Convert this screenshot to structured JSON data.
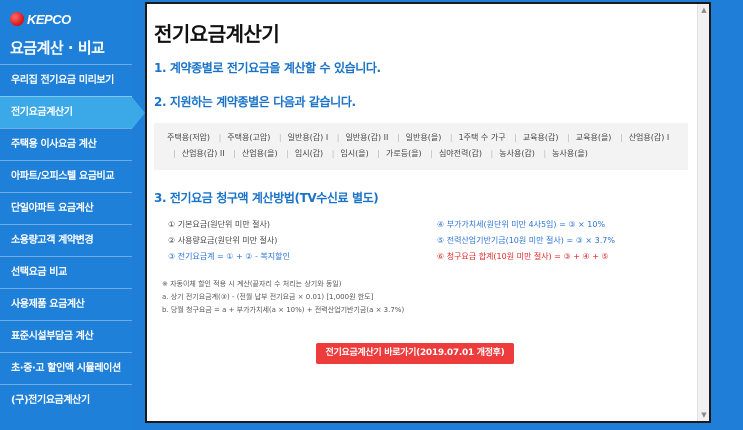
{
  "sidebar": {
    "logo_text": "KEPCO",
    "title": "요금계산 · 비교",
    "items": [
      {
        "label": "우리집 전기요금 미리보기"
      },
      {
        "label": "전기요금계산기"
      },
      {
        "label": "주택용 이사요금 계산"
      },
      {
        "label": "아파트/오피스텔 요금비교"
      },
      {
        "label": "단일아파트 요금계산"
      },
      {
        "label": "소용량고객 계약변경"
      },
      {
        "label": "선택요금 비교"
      },
      {
        "label": "사용제품 요금계산"
      },
      {
        "label": "표준시설부담금 계산"
      },
      {
        "label": "초·중·고 할인액 시뮬레이션"
      },
      {
        "label": "(구)전기요금계산기"
      }
    ],
    "active_index": 1
  },
  "main": {
    "title": "전기요금계산기",
    "heading1": "1. 계약종별로 전기요금을 계산할 수 있습니다.",
    "heading2": "2. 지원하는 계약종별은 다음과 같습니다.",
    "contract_types": [
      "주택용(저압)",
      "주택용(고압)",
      "일반용(갑) I",
      "일반용(갑) II",
      "일반용(을)",
      "1주택 수 가구",
      "교육용(갑)",
      "교육용(을)",
      "산업용(갑) I",
      "산업용(갑) II",
      "산업용(을)",
      "임시(갑)",
      "임시(을)",
      "가로등(을)",
      "심야전력(갑)",
      "농사용(갑)",
      "농사용(을)"
    ],
    "heading3": "3. 전기요금 청구액 계산방법(TV수신료 별도)",
    "calc_left": [
      "① 기본요금(원단위 미만 절사)",
      "② 사용량요금(원단위 미만 절사)",
      "③ 전기요금계 = ① + ② - 복지할인"
    ],
    "calc_right": [
      "④ 부가가치세(원단위 미만 4사5입) = ③ × 10%",
      "⑤ 전력산업기반기금(10원 미만 절사) = ③ × 3.7%",
      "⑥ 청구요금 합계(10원 미만 절사) = ③ + ④ + ⑤"
    ],
    "notes": [
      "※ 자동이체 할인 적용 시 계산(끝자리 수 처리는 상기와 동일)",
      "a. 상기 전기요금계(③) - (전월 납부 전기요금 × 0.01) [1,000원 한도]",
      "b. 당월 청구요금 = a + 부가가치세(a × 10%) + 전력산업기반기금(a × 3.7%)"
    ],
    "cta_label": "전기요금계산기 바로가기(2019.07.01 개정후)"
  },
  "colors": {
    "sidebar_bg": "#1f80d9",
    "active_item": "#3ba9e8",
    "heading_blue": "#1a73c8",
    "accent_red": "#ee3b3b"
  }
}
